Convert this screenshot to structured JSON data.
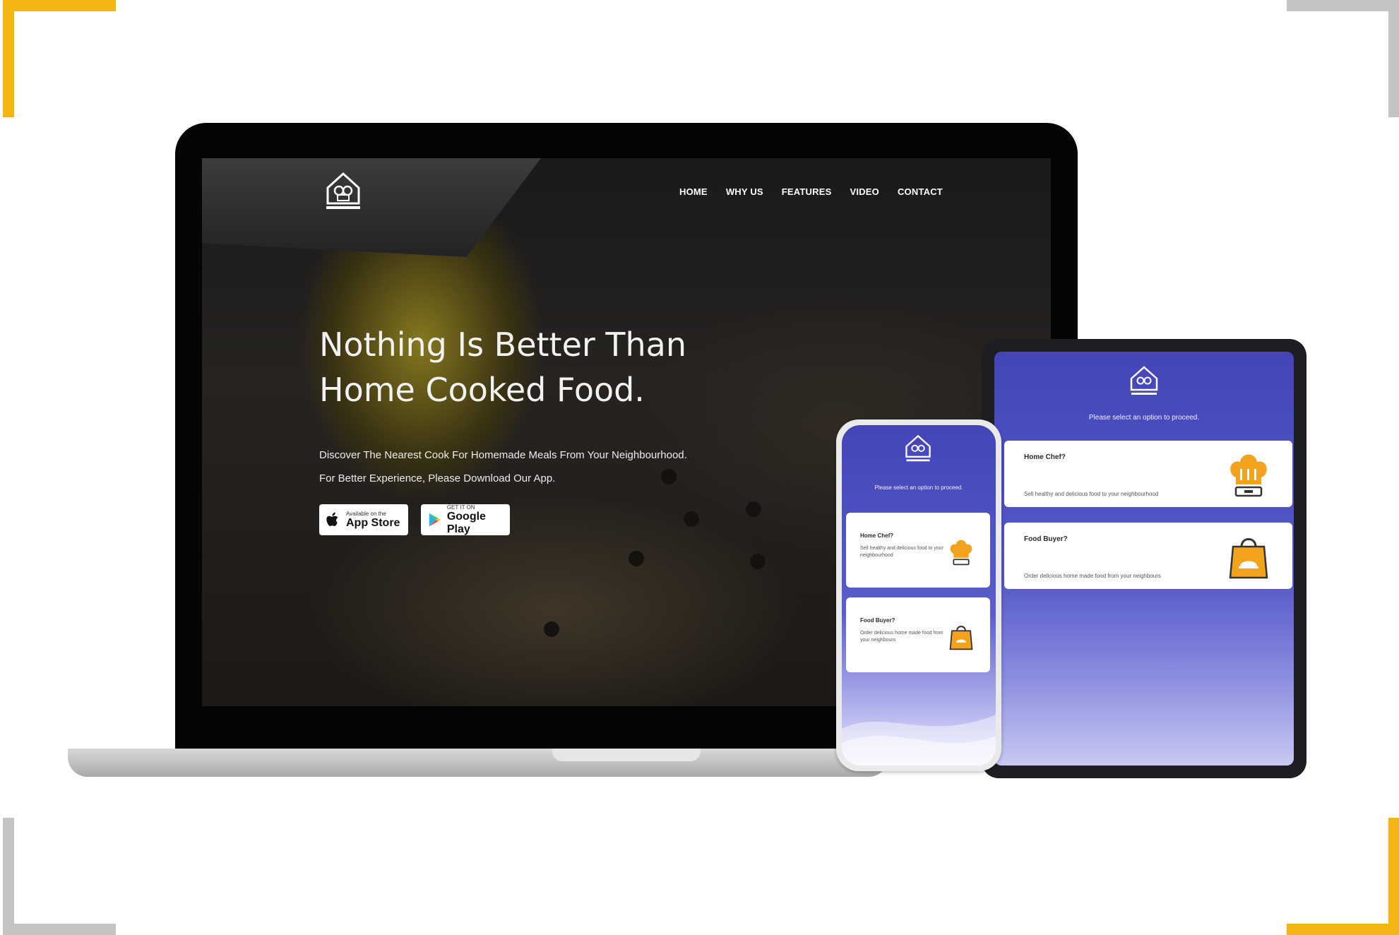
{
  "colors": {
    "corner_accent": "#f2b511",
    "corner_neutral": "#c4c4c4",
    "app_primary": "#4a4dbf",
    "icon_orange": "#f3a21e"
  },
  "site": {
    "logo_icon": "home-chef-logo-icon",
    "nav": [
      "HOME",
      "WHY US",
      "FEATURES",
      "VIDEO",
      "CONTACT"
    ],
    "hero": {
      "title_line1": "Nothing Is Better Than",
      "title_line2": "Home Cooked Food.",
      "subtitle_line1": "Discover The Nearest Cook For Homemade Meals From Your Neighbourhood.",
      "subtitle_line2": "For Better Experience, Please Download Our App."
    },
    "app_store": {
      "small": "Available on the",
      "big": "App Store",
      "icon": "apple-icon"
    },
    "google_play": {
      "small": "GET IT ON",
      "big": "Google Play",
      "icon": "google-play-icon"
    }
  },
  "app": {
    "prompt": "Please select an option to proceed.",
    "home_chef": {
      "title": "Home Chef?",
      "desc": "Sell healthy and delicious food to your neighbourhood",
      "icon": "chef-hat-icon"
    },
    "food_buyer": {
      "title": "Food Buyer?",
      "desc": "Order delicious home made food from your neighbours",
      "icon": "shopping-bag-icon"
    }
  }
}
